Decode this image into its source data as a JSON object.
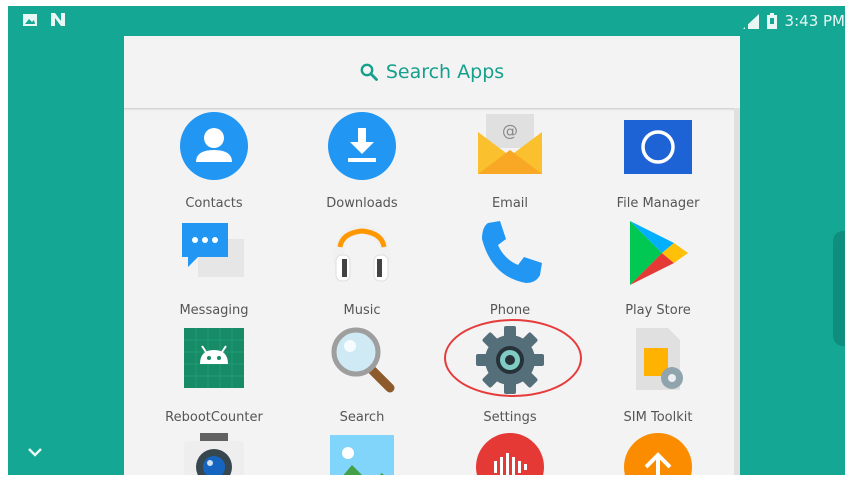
{
  "status_bar": {
    "time": "3:43 PM",
    "left_icons": [
      "image-icon",
      "n-icon"
    ],
    "right_icons": [
      "signal-icon",
      "battery-icon"
    ]
  },
  "search": {
    "label": "Search Apps",
    "icon": "search-icon"
  },
  "apps": [
    {
      "label": "Contacts",
      "icon": "contacts-icon"
    },
    {
      "label": "Downloads",
      "icon": "downloads-icon"
    },
    {
      "label": "Email",
      "icon": "email-icon"
    },
    {
      "label": "File Manager",
      "icon": "file-manager-icon"
    },
    {
      "label": "Messaging",
      "icon": "messaging-icon"
    },
    {
      "label": "Music",
      "icon": "music-icon"
    },
    {
      "label": "Phone",
      "icon": "phone-icon"
    },
    {
      "label": "Play Store",
      "icon": "play-store-icon"
    },
    {
      "label": "RebootCounter",
      "icon": "reboot-counter-icon"
    },
    {
      "label": "Search",
      "icon": "search-app-icon"
    },
    {
      "label": "Settings",
      "icon": "settings-icon"
    },
    {
      "label": "SIM Toolkit",
      "icon": "sim-toolkit-icon"
    },
    {
      "label": "",
      "icon": "camera-icon"
    },
    {
      "label": "",
      "icon": "gallery-icon"
    },
    {
      "label": "",
      "icon": "sound-recorder-icon"
    },
    {
      "label": "",
      "icon": "updater-icon"
    }
  ],
  "colors": {
    "background": "#14a894",
    "accent": "#15a08c",
    "highlight": "#e63b3b"
  }
}
